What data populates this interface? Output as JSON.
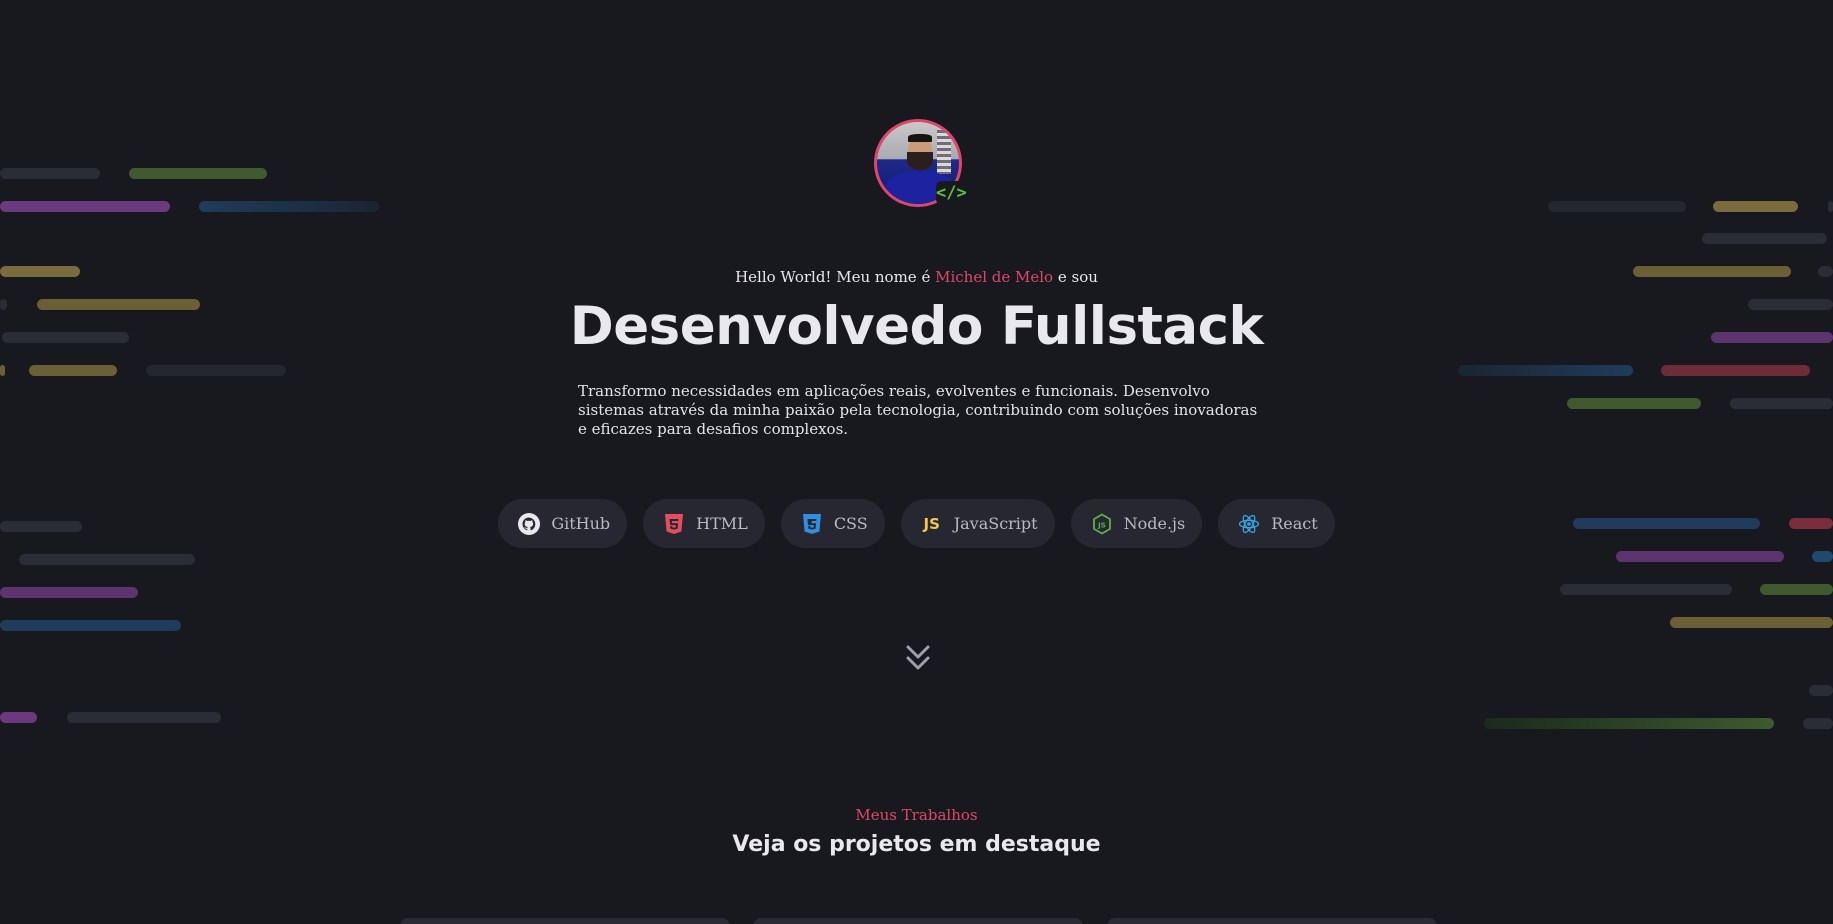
{
  "hero": {
    "hello_prefix": "Hello World! Meu nome é",
    "name": "Michel de Melo",
    "hello_suffix": "e sou",
    "title": "Desenvolvedo Fullstack",
    "description": "Transformo necessidades em aplicações reais, evolventes e funcionais. Desenvolvo sistemas através da minha paixão pela tecnologia, contribuindo com soluções inovadoras e eficazes para desafios complexos.",
    "avatar_badge": "</>"
  },
  "techs": [
    {
      "label": "GitHub",
      "icon": "github-icon"
    },
    {
      "label": "HTML",
      "icon": "html5-icon"
    },
    {
      "label": "CSS",
      "icon": "css3-icon"
    },
    {
      "label": "JavaScript",
      "icon": "javascript-icon"
    },
    {
      "label": "Node.js",
      "icon": "nodejs-icon"
    },
    {
      "label": "React",
      "icon": "react-icon"
    }
  ],
  "scroll_icon": "double-chevron-down-icon",
  "section": {
    "kicker": "Meus Trabalhos",
    "title": "Veja os projetos em destaque"
  },
  "colors": {
    "background": "#18191e",
    "accent": "#e0466a",
    "chip_bg": "#262730",
    "html": "#e34f5c",
    "css": "#2f8fe0",
    "js": "#f1c84b",
    "node": "#5bb04a",
    "react": "#3aa4e6",
    "badge_green": "#5bc236"
  }
}
